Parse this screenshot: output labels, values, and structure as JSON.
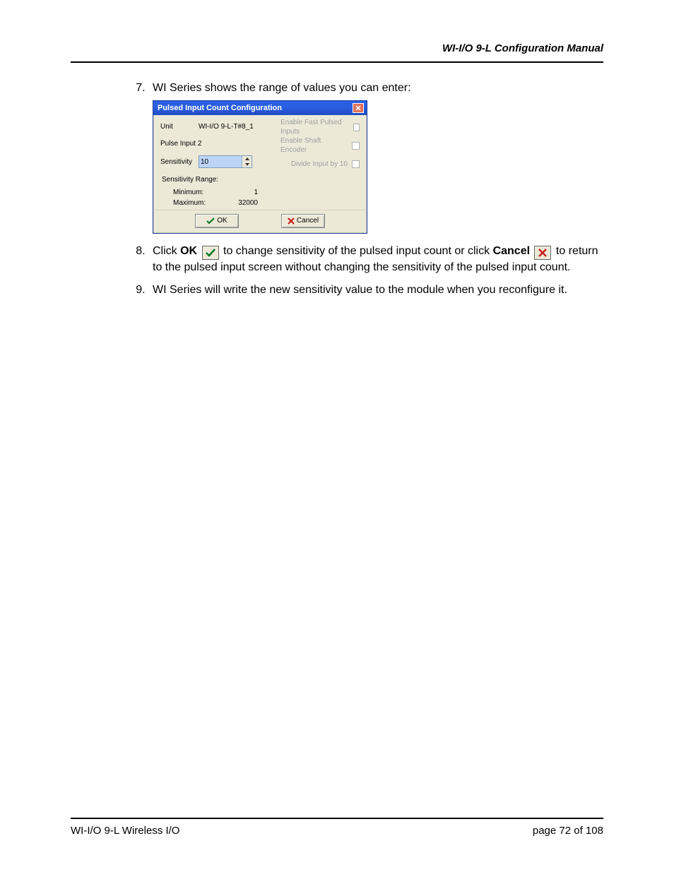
{
  "header": {
    "doc_title": "WI-I/O 9-L Configuration Manual"
  },
  "list": {
    "start": 7,
    "item7": "WI Series shows the range of values you can enter:",
    "item8_pre": "Click ",
    "item8_ok": "OK",
    "item8_mid": " to change sensitivity of the pulsed input count or click ",
    "item8_cancel": "Cancel",
    "item8_post": " to return to the pulsed input screen without changing the sensitivity of the pulsed input count.",
    "item9": "WI Series will write the new sensitivity value to the module when you reconfigure it."
  },
  "dialog": {
    "title": "Pulsed Input Count Configuration",
    "unit_label": "Unit",
    "unit_value": "WI-I/O 9-L-T#8_1",
    "pulse_label": "Pulse Input 2",
    "sensitivity_label": "Sensitivity",
    "sensitivity_value": "10",
    "range_title": "Sensitivity Range:",
    "min_label": "Minimum:",
    "min_value": "1",
    "max_label": "Maximum:",
    "max_value": "32000",
    "opt_fast": "Enable Fast Pulsed Inputs",
    "opt_shaft": "Enable Shaft Encoder",
    "opt_divide": "Divide Input by 10",
    "ok_label": "OK",
    "cancel_label": "Cancel"
  },
  "footer": {
    "left": "WI-I/O 9-L Wireless I/O",
    "right_prefix": "page ",
    "page_current": "72",
    "right_of": " of ",
    "page_total": "108"
  }
}
